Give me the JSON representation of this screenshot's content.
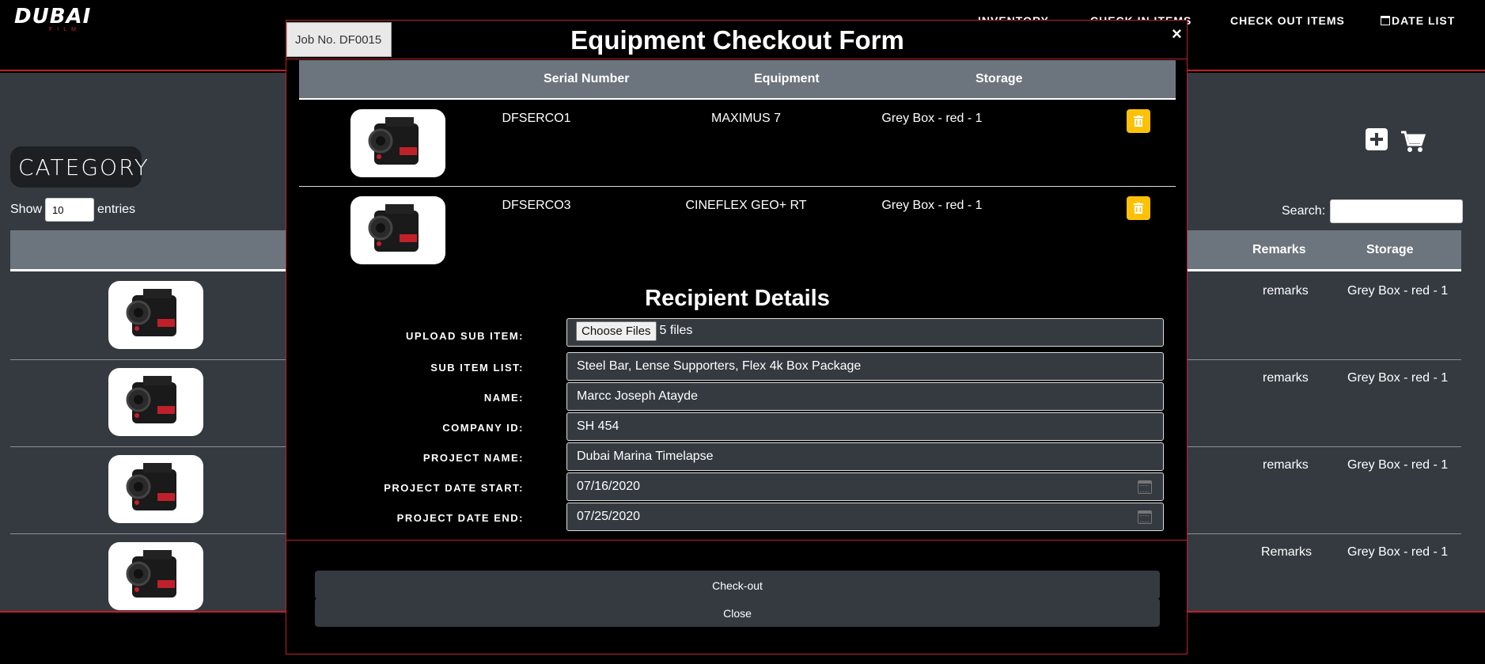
{
  "brand": {
    "logo_main": "DUBAI",
    "logo_sub": "FILM"
  },
  "nav": {
    "inventory": "INVENTORY",
    "check_in": "CHECK IN ITEMS",
    "check_out": "CHECK OUT ITEMS",
    "date_list": "DATE LIST"
  },
  "page": {
    "category": "CATEGORY",
    "show_label": "Show",
    "show_value": "10",
    "entries_label": "entries",
    "search_label": "Search:",
    "columns": {
      "remarks": "Remarks",
      "storage": "Storage"
    },
    "rows": [
      {
        "remarks": "remarks",
        "storage": "Grey Box - red - 1"
      },
      {
        "remarks": "remarks",
        "storage": "Grey Box - red - 1"
      },
      {
        "remarks": "remarks",
        "storage": "Grey Box - red - 1"
      },
      {
        "remarks": "Remarks",
        "storage": "Grey Box - red - 1"
      }
    ]
  },
  "modal": {
    "job_no": "Job No. DF0015",
    "title": "Equipment Checkout Form",
    "close_symbol": "×",
    "columns": {
      "serial": "Serial Number",
      "equipment": "Equipment",
      "storage": "Storage"
    },
    "items": [
      {
        "serial": "DFSERCO1",
        "equipment": "MAXIMUS 7",
        "storage": "Grey Box - red - 1"
      },
      {
        "serial": "DFSERCO3",
        "equipment": "CINEFLEX GEO+ RT",
        "storage": "Grey Box - red - 1"
      }
    ],
    "recipient_title": "Recipient Details",
    "fields": {
      "upload_label": "UPLOAD SUB ITEM:",
      "upload_button": "Choose Files",
      "upload_value": "5 files",
      "sub_item_label": "SUB ITEM LIST:",
      "sub_item_value": "Steel Bar, Lense Supporters, Flex 4k Box Package",
      "name_label": "NAME:",
      "name_value": "Marcc Joseph Atayde",
      "company_label": "COMPANY ID:",
      "company_value": "SH 454",
      "project_label": "PROJECT NAME:",
      "project_value": "Dubai Marina Timelapse",
      "start_label": "PROJECT DATE START:",
      "start_value": "07/16/2020",
      "end_label": "PROJECT DATE END:",
      "end_value": "07/25/2020"
    },
    "checkout_button": "Check-out",
    "close_button": "Close"
  },
  "colors": {
    "accent_red": "#c0202a",
    "delete_yellow": "#ffc107",
    "panel_gray": "#343a40",
    "header_gray": "#6c757d"
  }
}
